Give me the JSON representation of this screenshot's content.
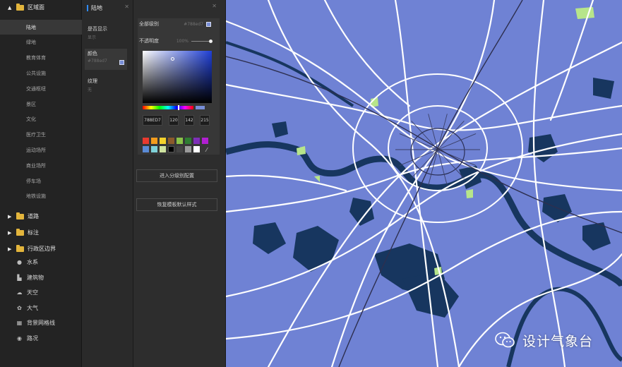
{
  "tree": {
    "root": {
      "label": "区域面",
      "expanded": true
    },
    "sub_items": [
      "陆地",
      "绿地",
      "教育体育",
      "公共设施",
      "交通枢纽",
      "景区",
      "文化",
      "医疗卫生",
      "运动场所",
      "商业场所",
      "停车场",
      "地铁设施"
    ],
    "active_sub": "陆地",
    "folders": [
      {
        "label": "道路"
      },
      {
        "label": "标注"
      },
      {
        "label": "行政区边界"
      }
    ],
    "items": [
      {
        "label": "水系",
        "icon": "water-drop-icon"
      },
      {
        "label": "建筑物",
        "icon": "building-icon"
      },
      {
        "label": "天空",
        "icon": "cloud-icon"
      },
      {
        "label": "大气",
        "icon": "atmosphere-icon"
      },
      {
        "label": "背景网格线",
        "icon": "grid-icon"
      },
      {
        "label": "路况",
        "icon": "traffic-icon"
      }
    ]
  },
  "props": {
    "title": "陆地",
    "visible": {
      "label": "是否显示",
      "value": "显示"
    },
    "color": {
      "label": "颜色",
      "value": "#788ed7"
    },
    "texture": {
      "label": "纹理",
      "value": "无"
    }
  },
  "picker": {
    "all_levels_label": "全部级别",
    "all_levels_value": "#788ed7",
    "opacity_label": "不透明度",
    "opacity_value": "100%",
    "opacity": 1.0,
    "hex": "788ED7",
    "r": "120",
    "g": "142",
    "b": "215",
    "hue_position": 0.7,
    "presets": [
      "#e83a2f",
      "#f39c1d",
      "#f3d12c",
      "#8b5a2b",
      "#8bc34a",
      "#2e7d32",
      "#7e2fb8",
      "#b11fd1",
      "#5a8bd6",
      "#7fd1d8",
      "#cfe3a0",
      "#000000",
      "#444444",
      "#9b9b9b",
      "#ffffff"
    ],
    "level_config_button": "进入分级别配置",
    "restore_button": "恢复模板默认样式"
  },
  "map": {
    "land_color": "#6f82d4",
    "water_color": "#17365f",
    "road_color": "#ffffff",
    "green_color": "#b7e58a",
    "watermark": "设计气象台"
  }
}
